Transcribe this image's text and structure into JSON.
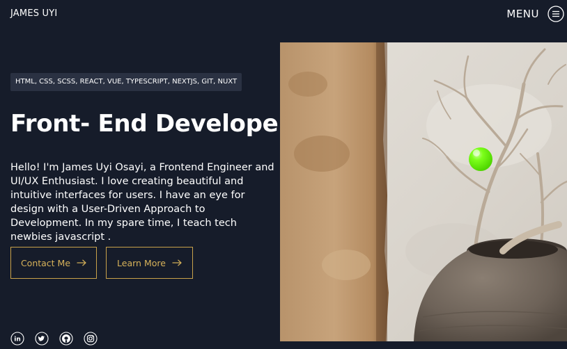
{
  "header": {
    "brand": "JAMES UYI",
    "menu_label": "MENU",
    "menu_icon": "hamburger-circle-icon"
  },
  "hero": {
    "skills": "HTML, CSS, SCSS, REACT, VUE, TYPESCRIPT, NEXTJS, GIT, NUXT",
    "title": "Front- End Developer",
    "bio": "Hello! I'm James Uyi Osayi, a Frontend Engineer and UI/UX Enthusiast. I love creating beautiful and intuitive interfaces for users. I have an eye for design with a User-Driven Approach to Development. In my spare time, I teach tech newbies javascript .",
    "contact_label": "Contact Me",
    "learn_label": "Learn More",
    "arrow_icon": "arrow-right-icon"
  },
  "socials": [
    "linkedin-icon",
    "twitter-icon",
    "github-icon",
    "instagram-icon"
  ],
  "colors": {
    "background": "#161c2a",
    "accent": "#c9a24a",
    "skills_bg": "#2a3142",
    "orb": "#7cff1a"
  }
}
